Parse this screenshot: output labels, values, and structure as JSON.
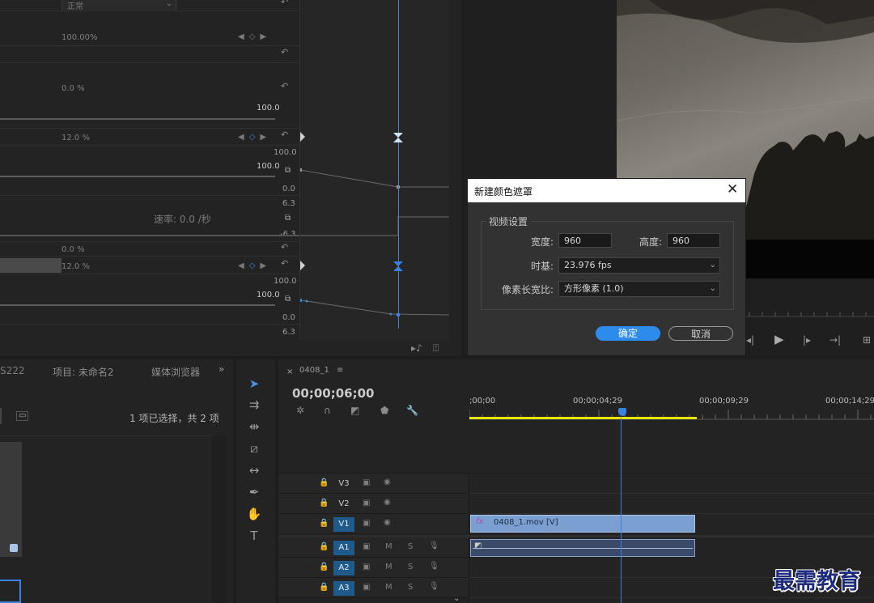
{
  "effect_controls": {
    "blend_mode": "正常",
    "opacity_value": "100.00%",
    "rotation_value": "0.0 %",
    "slider1_max": "100.0",
    "param2_value": "12.0 %",
    "graph1_top": "100.0",
    "slider2_max": "100.0",
    "graph1_bottom": "0.0",
    "velocity_top": "6.3",
    "velocity_label": "速率: 0.0 /秒",
    "velocity_bottom": "-6.3",
    "param3_value": "0.0 %",
    "param4_value": "12.0 %",
    "graph2_top": "100.0",
    "slider3_max": "100.0",
    "graph2_bottom": "0.0",
    "velocity2_top": "6.3"
  },
  "dialog": {
    "title": "新建颜色遮罩",
    "group_label": "视频设置",
    "width_label": "宽度:",
    "width_value": "960",
    "height_label": "高度:",
    "height_value": "960",
    "timebase_label": "时基:",
    "timebase_value": "23.976 fps",
    "pixel_aspect_label": "像素长宽比:",
    "pixel_aspect_value": "方形像素 (1.0)",
    "ok_label": "确定",
    "cancel_label": "取消"
  },
  "project_panel": {
    "tab_partial": "S222",
    "tab_project": "项目: 未命名2",
    "tab_media": "媒体浏览器",
    "selection_status": "1 项已选择，共 2 项"
  },
  "timeline": {
    "sequence_name": "0408_1",
    "timecode": "00;00;06;00",
    "ruler": [
      ";00;00",
      "00;00;04;29",
      "00;00;09;29",
      "00;00;14;29"
    ],
    "tracks": [
      {
        "label": "V3",
        "on": false
      },
      {
        "label": "V2",
        "on": false
      },
      {
        "label": "V1",
        "on": true
      },
      {
        "label": "A1",
        "on": true
      },
      {
        "label": "A2",
        "on": true
      },
      {
        "label": "A3",
        "on": true
      }
    ],
    "video_clip_label": "0408_1.mov [V]",
    "audio_toggle_m": "M",
    "audio_toggle_s": "S"
  },
  "watermark": "最需教育",
  "colors": {
    "accent": "#2d8ceb",
    "playhead": "#3b82e0",
    "video_clip": "#7b9fd1",
    "audio_clip": "#3a4a68",
    "work_area": "#e6e600"
  }
}
